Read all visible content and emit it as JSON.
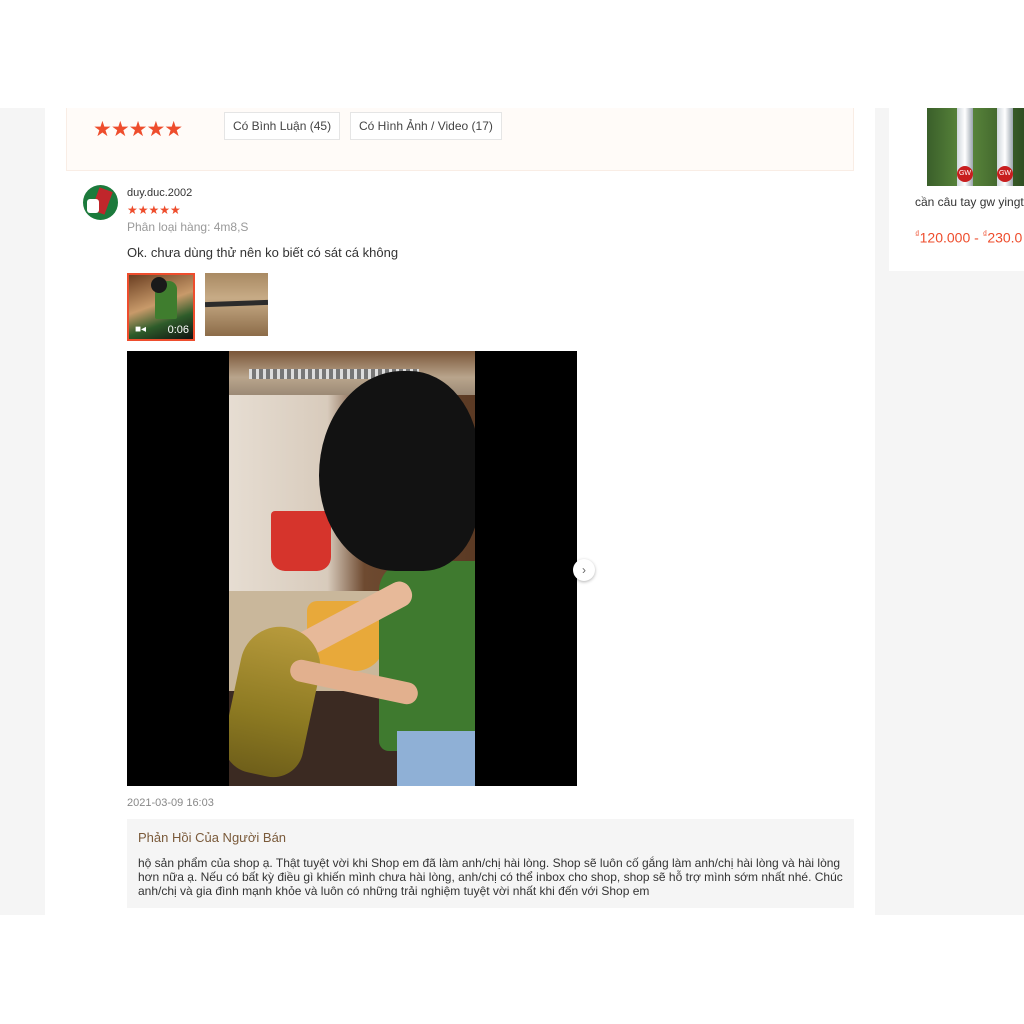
{
  "ratings_overview": {
    "stars": "★★★★★",
    "filters": [
      {
        "label": "Có Bình Luận (45)"
      },
      {
        "label": "Có Hình Ảnh / Video (17)"
      }
    ]
  },
  "review": {
    "username": "duy.duc.2002",
    "stars": "★★★★★",
    "rating": 5,
    "variant": "Phân loại hàng: 4m8,S",
    "comment": "Ok. chưa dùng thử nên ko biết có sát cá không",
    "media": [
      {
        "type": "video",
        "duration": "0:06",
        "icon": "video-camera-icon"
      },
      {
        "type": "image"
      }
    ],
    "date": "2021-03-09 16:03",
    "seller_reply": {
      "title": "Phản Hồi Của Người Bán",
      "text": "hộ sản phẩm của shop ạ. Thật tuyệt vời khi Shop em đã làm anh/chị hài lòng. Shop sẽ luôn cố gắng làm anh/chị hài lòng và hài lòng hơn nữa ạ. Nếu có bất kỳ điều gì khiến mình chưa hài lòng, anh/chị có thể inbox cho shop, shop sẽ hỗ trợ mình sớm nhất nhé. Chúc anh/chị và gia đình mạnh khỏe và luôn có những trải nghiệm tuyệt vời nhất khi đến với Shop em"
    }
  },
  "side_product": {
    "name": "cần câu tay gw yingt",
    "price_currency": "₫",
    "price_low": "120.000",
    "price_sep": " - ",
    "price_high": "230.0"
  },
  "colors": {
    "accent": "#ee4d2d"
  }
}
